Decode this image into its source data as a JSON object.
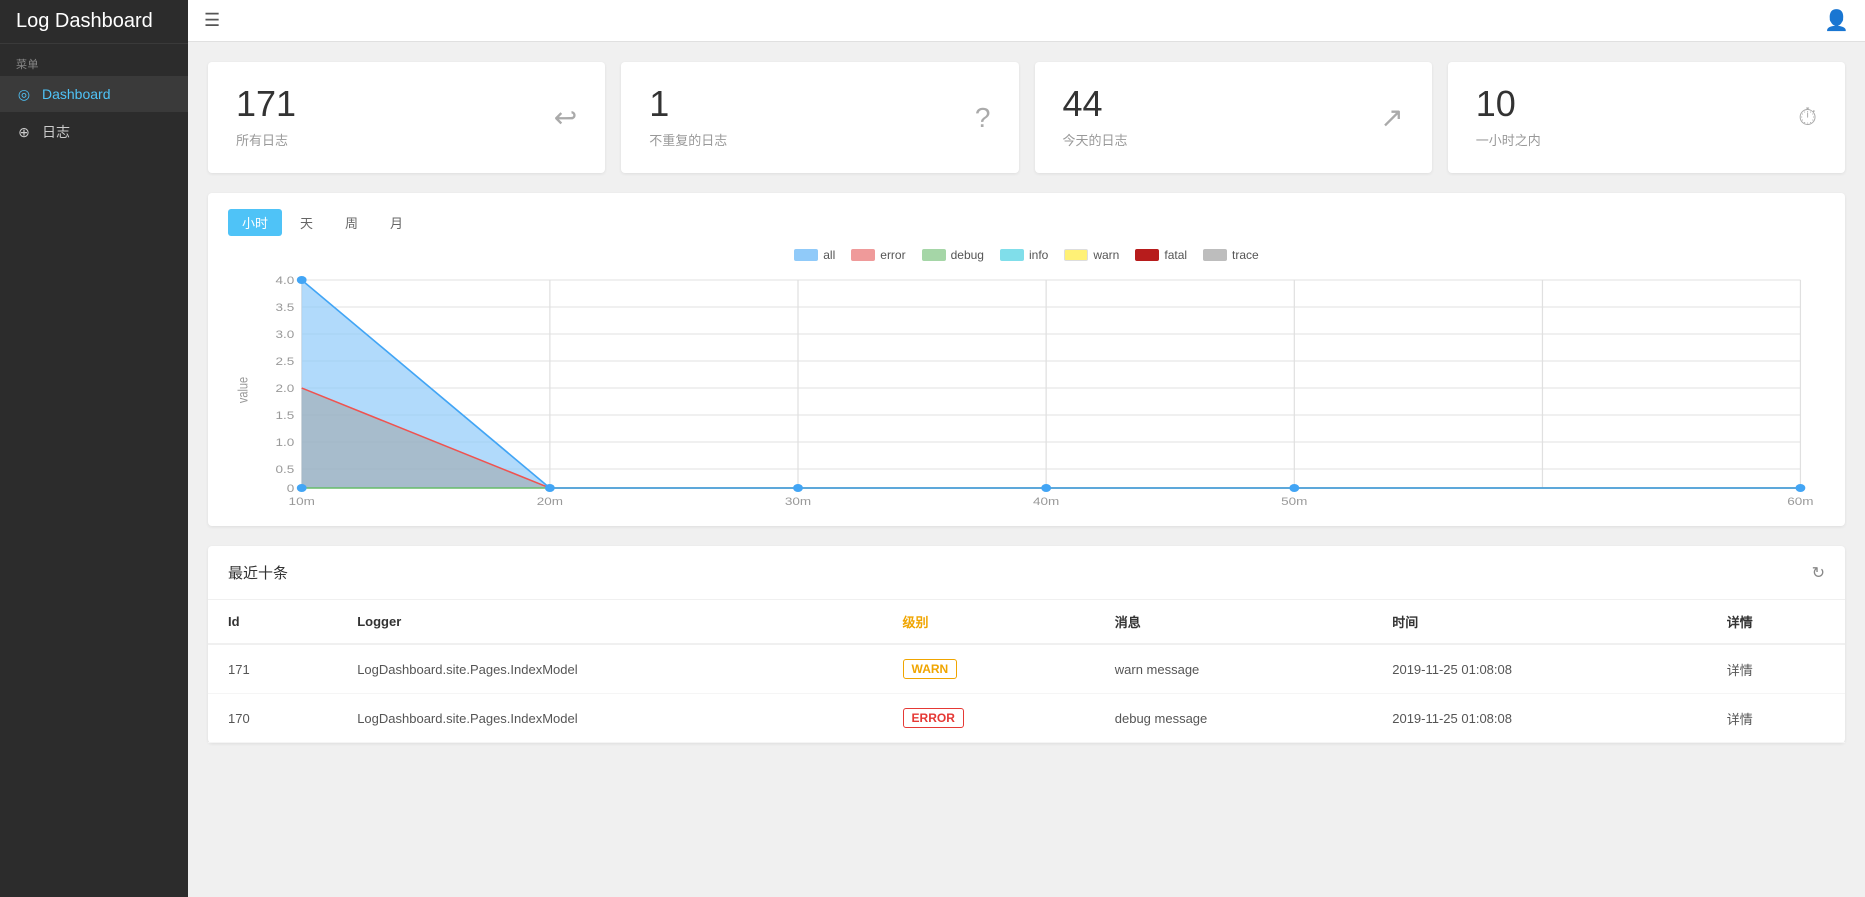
{
  "sidebar": {
    "title": "Log Dashboard",
    "section_label": "菜单",
    "items": [
      {
        "id": "dashboard",
        "label": "Dashboard",
        "icon": "◎",
        "active": true
      },
      {
        "id": "logs",
        "label": "日志",
        "icon": "⊕",
        "active": false
      }
    ]
  },
  "topbar": {
    "menu_icon": "☰",
    "user_icon": "👤"
  },
  "stats": [
    {
      "number": "171",
      "label": "所有日志",
      "icon": "↩"
    },
    {
      "number": "1",
      "label": "不重复的日志",
      "icon": "?"
    },
    {
      "number": "44",
      "label": "今天的日志",
      "icon": "↗"
    },
    {
      "number": "10",
      "label": "一小时之内",
      "icon": "🕐"
    }
  ],
  "chart": {
    "tabs": [
      "小时",
      "天",
      "周",
      "月"
    ],
    "active_tab": "小时",
    "legend": [
      {
        "label": "all",
        "color": "#90caf9"
      },
      {
        "label": "error",
        "color": "#ef9a9a"
      },
      {
        "label": "debug",
        "color": "#a5d6a7"
      },
      {
        "label": "info",
        "color": "#80deea"
      },
      {
        "label": "warn",
        "color": "#fff176"
      },
      {
        "label": "fatal",
        "color": "#b71c1c"
      },
      {
        "label": "trace",
        "color": "#bdbdbd"
      }
    ],
    "y_axis_label": "value",
    "y_ticks": [
      "4.0",
      "3.5",
      "3.0",
      "2.5",
      "2.0",
      "1.5",
      "1.0",
      "0.5",
      "0"
    ],
    "x_ticks": [
      "10m",
      "20m",
      "30m",
      "40m",
      "50m",
      "60m"
    ]
  },
  "table": {
    "title": "最近十条",
    "refresh_icon": "↻",
    "columns": [
      {
        "key": "id",
        "label": "Id"
      },
      {
        "key": "logger",
        "label": "Logger"
      },
      {
        "key": "level",
        "label": "级别"
      },
      {
        "key": "message",
        "label": "消息"
      },
      {
        "key": "time",
        "label": "时间"
      },
      {
        "key": "detail",
        "label": "详情"
      }
    ],
    "rows": [
      {
        "id": "171",
        "logger": "LogDashboard.site.Pages.IndexModel",
        "level": "WARN",
        "level_type": "warn",
        "message": "warn message",
        "time": "2019-11-25 01:08:08",
        "detail": "详情"
      },
      {
        "id": "170",
        "logger": "LogDashboard.site.Pages.IndexModel",
        "level": "ERROR",
        "level_type": "error",
        "message": "debug message",
        "time": "2019-11-25 01:08:08",
        "detail": "详情"
      }
    ]
  }
}
